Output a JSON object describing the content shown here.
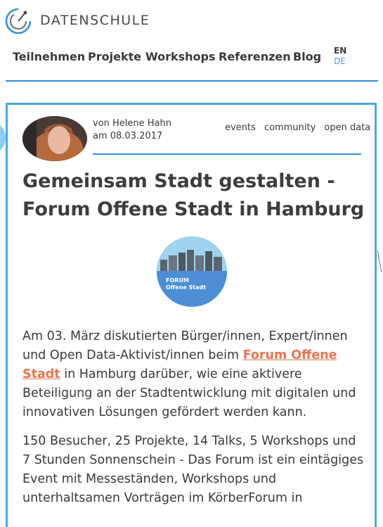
{
  "brand": {
    "name": "DATENSCHULE"
  },
  "nav": {
    "items": [
      "Teilnehmen",
      "Projekte",
      "Workshops",
      "Referenzen",
      "Blog"
    ]
  },
  "lang": {
    "en": "EN",
    "de": "DE"
  },
  "post": {
    "author_line": "von Helene Hahn",
    "date_line": "am 08.03.2017",
    "tags": [
      "events",
      "community",
      "open data"
    ],
    "title": "Gemeinsam Stadt gestalten - Forum Offene Stadt in Hamburg",
    "forum_logo": {
      "line1": "FORUM",
      "line2": "Offene Stadt"
    },
    "para1_before": "Am 03. März diskutierten Bürger/innen, Expert/innen und Open Data-Aktivist/innen beim ",
    "para1_link": "Forum Offene Stadt",
    "para1_after": " in Hamburg darüber, wie eine aktivere Beteiligung an der Stadtentwicklung mit digitalen und innovativen Lösungen gefördert werden kann.",
    "para2": "150 Besucher, 25 Projekte, 14 Talks, 5 Workshops und 7 Stunden Sonnenschein - Das Forum ist ein eintägiges Event mit Messeständen, Workshops und unterhaltsamen Vorträgen im KörberForum in"
  },
  "colors": {
    "accent": "#2f8fd6",
    "link": "#e8744f",
    "card_border": "#4aa8e0"
  }
}
